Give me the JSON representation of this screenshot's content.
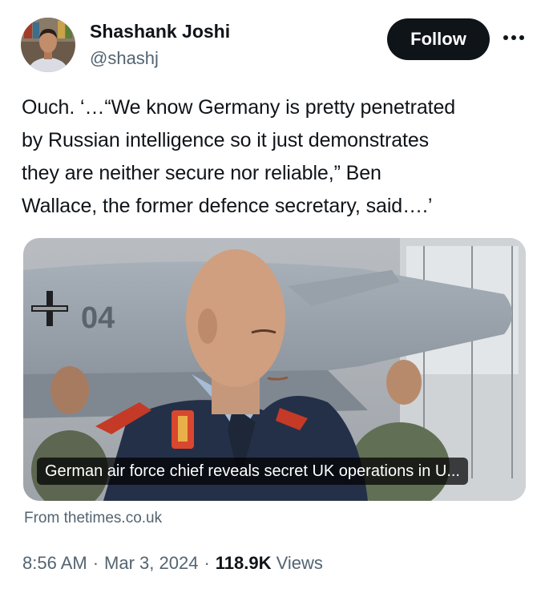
{
  "author": {
    "display_name": "Shashank Joshi",
    "handle": "@shashj"
  },
  "actions": {
    "follow_label": "Follow",
    "more_icon": "more-horizontal-icon"
  },
  "tweet": {
    "lines": [
      "Ouch. ‘…“We know Germany is pretty penetrated",
      "by Russian intelligence so it just demonstrates",
      "they are neither secure nor reliable,” Ben",
      "Wallace, the former defence secretary, said….’"
    ]
  },
  "card": {
    "headline": "German air force chief reveals secret UK operations in U...",
    "aircraft_marking": "04",
    "source": "From thetimes.co.uk"
  },
  "meta": {
    "time": "8:56 AM",
    "date": "Mar 3, 2024",
    "views_count": "118.9K",
    "views_label": "Views"
  },
  "colors": {
    "text_primary": "#0f1419",
    "text_secondary": "#536471",
    "follow_bg": "#0f1419",
    "follow_text": "#ffffff"
  }
}
